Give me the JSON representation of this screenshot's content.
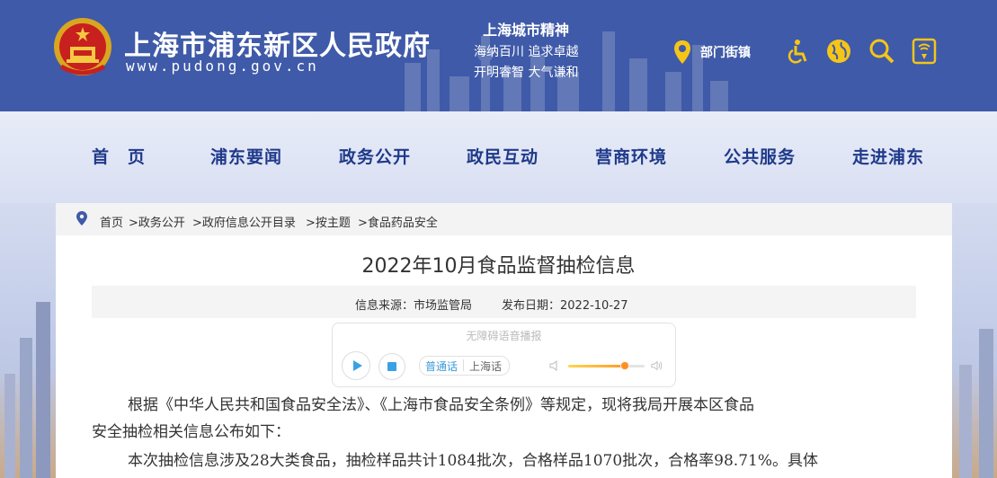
{
  "header": {
    "site_title": "上海市浦东新区人民政府",
    "site_url": "www.pudong.gov.cn",
    "motto_title": "上海城市精神",
    "motto_lines": [
      "海纳百川  追求卓越",
      "开明睿智  大气谦和"
    ],
    "dept_label": "部门街镇",
    "icons": [
      "accessibility-icon",
      "globe-icon",
      "search-icon",
      "elderly-mode-icon"
    ],
    "background_color": "#3f5aa8"
  },
  "nav": {
    "items": [
      "首　页",
      "浦东要闻",
      "政务公开",
      "政民互动",
      "营商环境",
      "公共服务",
      "走进浦东"
    ],
    "color": "#1f3a8a"
  },
  "breadcrumb": {
    "items": [
      "首页",
      ">政务公开",
      ">政府信息公开目录",
      ">按主题",
      ">食品药品安全"
    ]
  },
  "article": {
    "title": "2022年10月食品监督抽检信息",
    "source_label": "信息来源：市场监管局",
    "date_label": "发布日期：2022-10-27"
  },
  "player": {
    "title": "无障碍语音播报",
    "lang_selected": "普通话",
    "lang_other": "上海话",
    "volume_level": 0.74
  },
  "body": {
    "lines": [
      "根据《中华人民共和国食品安全法》、《上海市食品安全条例》等规定，现将我局开展本区食品",
      "安全抽检相关信息公布如下：",
      "本次抽检信息涉及28大类食品，抽检样品共计1084批次，合格样品1070批次，合格率98.71%。具体"
    ]
  }
}
